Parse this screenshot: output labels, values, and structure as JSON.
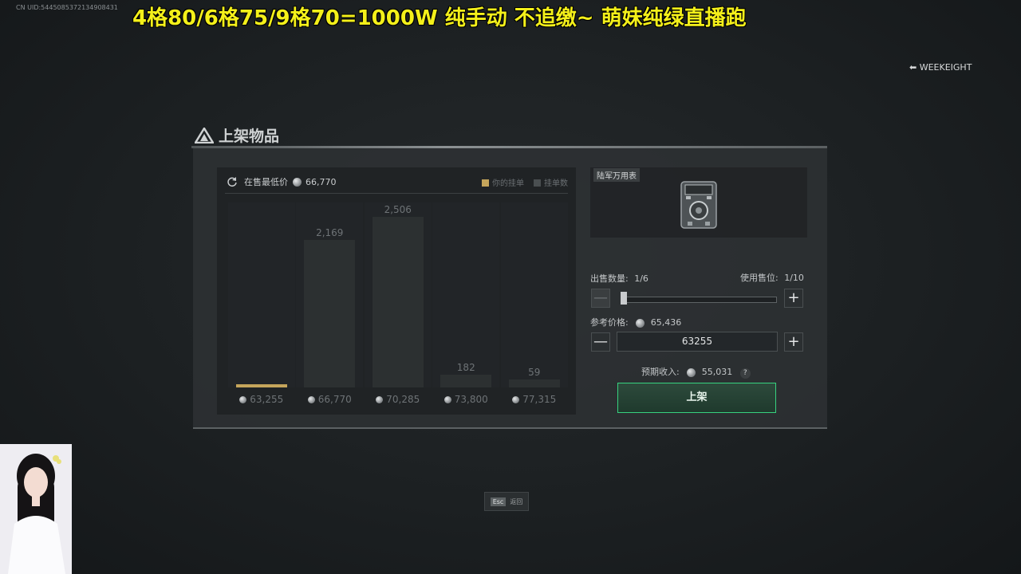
{
  "uid_text": "CN UID:5445085372134908431",
  "banner_text": "4格80/6格75/9格70=1000W 纯手动 不追缴~ 萌妹纯绿直播跑",
  "watermark": "WEEKEIGHT",
  "panel": {
    "title": "上架物品"
  },
  "chart": {
    "lowest_label": "在售最低价",
    "lowest_value": "66,770",
    "legend_mine": "你的挂单",
    "legend_count": "挂单数"
  },
  "chart_data": {
    "type": "bar",
    "categories": [
      "63,255",
      "66,770",
      "70,285",
      "73,800",
      "77,315"
    ],
    "values": [
      null,
      2169,
      2506,
      182,
      59
    ],
    "value_labels": [
      "",
      "2,169",
      "2,506",
      "182",
      "59"
    ],
    "highlight_index": 0,
    "series": [
      {
        "name": "挂单数",
        "values": [
          null,
          2169,
          2506,
          182,
          59
        ]
      }
    ]
  },
  "item": {
    "tag": "陆军万用表"
  },
  "sell": {
    "qty_label": "出售数量:",
    "qty_value": "1/6",
    "slot_label": "使用售位:",
    "slot_value": "1/10",
    "slider_fraction": 0.0,
    "minus": "—",
    "plus": "+",
    "ref_label": "参考价格:",
    "ref_value": "65,436",
    "price_input": "63255",
    "expected_label": "预期收入:",
    "expected_value": "55,031",
    "help": "?",
    "submit": "上架"
  },
  "esc": {
    "key": "Esc",
    "label": "返回"
  },
  "colors": {
    "accent_green": "#37d27f",
    "mine_bar": "#c5a55b",
    "banner": "#f4f01a"
  }
}
